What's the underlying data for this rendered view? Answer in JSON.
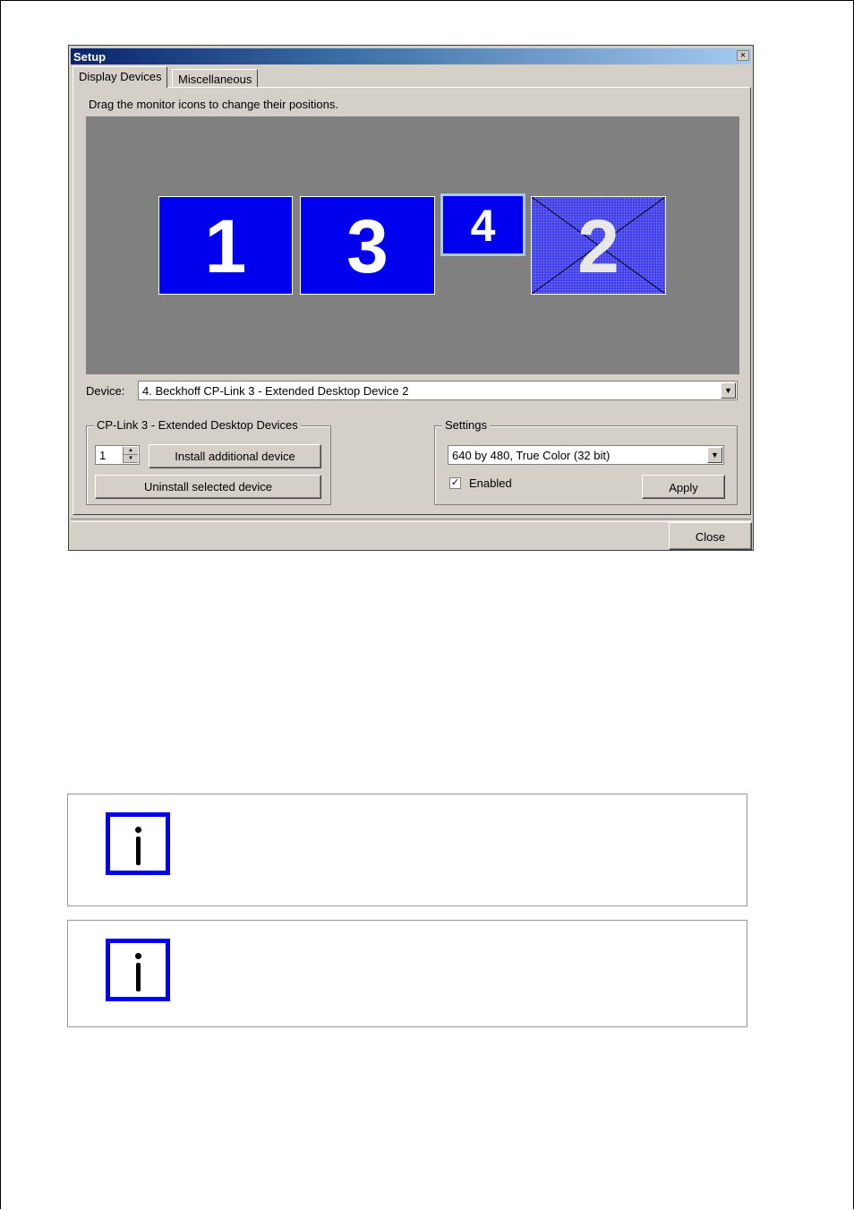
{
  "window": {
    "title": "Setup",
    "close_glyph": "×"
  },
  "tabs": [
    {
      "label": "Display Devices",
      "active": true
    },
    {
      "label": "Miscellaneous",
      "active": false
    }
  ],
  "instruction": "Drag the monitor icons to change their positions.",
  "monitors": [
    {
      "label": "1",
      "selected": false,
      "disabled": false
    },
    {
      "label": "3",
      "selected": false,
      "disabled": false
    },
    {
      "label": "4",
      "selected": true,
      "disabled": false
    },
    {
      "label": "2",
      "selected": false,
      "disabled": true
    }
  ],
  "device": {
    "label": "Device:",
    "value": "4. Beckhoff CP-Link 3 - Extended Desktop Device 2"
  },
  "extended_group": {
    "title": "CP-Link 3 - Extended Desktop Devices",
    "count_value": "1",
    "install_label": "Install additional device",
    "uninstall_label": "Uninstall selected device"
  },
  "settings_group": {
    "title": "Settings",
    "resolution_value": "640 by 480, True Color (32 bit)",
    "enabled_label": "Enabled",
    "enabled_checked": true,
    "apply_label": "Apply"
  },
  "footer": {
    "close_label": "Close"
  },
  "colors": {
    "monitor_blue": "#0000ee",
    "dialog_gray": "#d4d0c8",
    "titlebar_start": "#0a246a",
    "info_icon_blue": "#0000ee"
  },
  "icons": {
    "dropdown": "chevron-down-icon",
    "info": "info-icon",
    "check": "checkmark-icon"
  }
}
